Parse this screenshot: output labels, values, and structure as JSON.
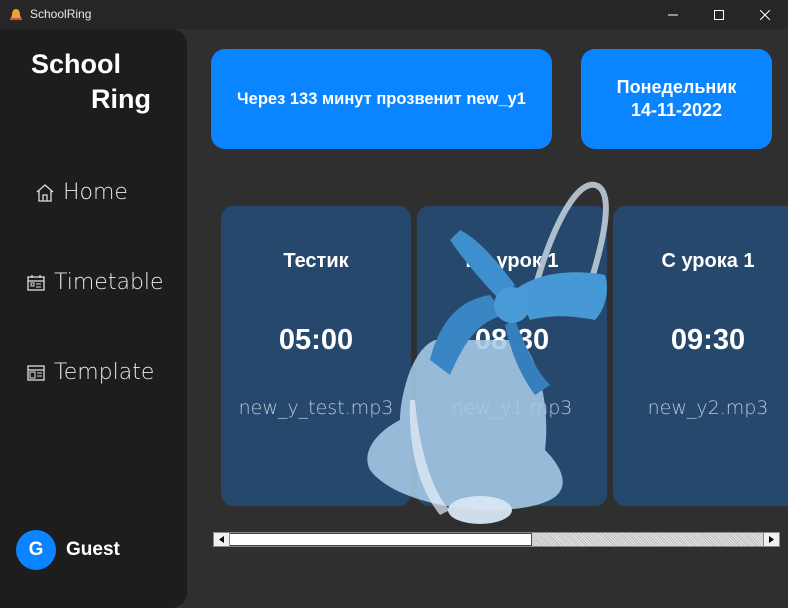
{
  "window": {
    "title": "SchoolRing"
  },
  "sidebar": {
    "logo_line1": "School",
    "logo_line2": "Ring",
    "items": [
      {
        "label": "Home",
        "icon": "home-icon"
      },
      {
        "label": "Timetable",
        "icon": "timetable-icon"
      },
      {
        "label": "Template",
        "icon": "template-icon"
      }
    ],
    "user": {
      "initial": "G",
      "name": "Guest"
    }
  },
  "header": {
    "countdown": "Через 133 минут прозвенит new_y1",
    "day": "Понедельник",
    "date": "14-11-2022"
  },
  "bells": [
    {
      "name": "Тестик",
      "time": "05:00",
      "file": "new_y_test.mp3"
    },
    {
      "name": "На урок 1",
      "time": "08:30",
      "file": "new_y1.mp3"
    },
    {
      "name": "С урока 1",
      "time": "09:30",
      "file": "new_y2.mp3"
    }
  ],
  "colors": {
    "accent": "#0a84ff",
    "card": "#26486c",
    "sidebar": "#1d1d1d",
    "background": "#2f2f2f"
  }
}
